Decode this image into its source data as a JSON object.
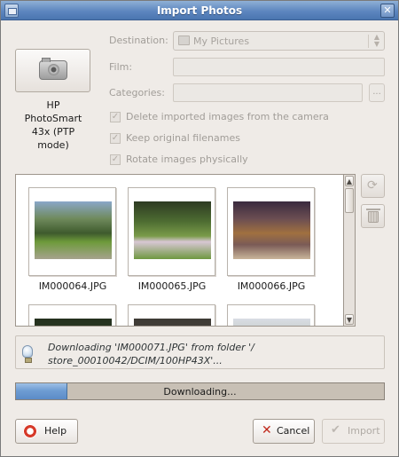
{
  "window": {
    "title": "Import Photos"
  },
  "device": {
    "name_lines": [
      "HP",
      "PhotoSmart",
      "43x (PTP",
      "mode)"
    ]
  },
  "form": {
    "destination_label": "Destination:",
    "destination_value": "My Pictures",
    "film_label": "Film:",
    "categories_label": "Categories:",
    "categories_button": "..."
  },
  "options": [
    {
      "label": "Delete imported images from the camera",
      "checked": true,
      "enabled": false
    },
    {
      "label": "Keep original filenames",
      "checked": true,
      "enabled": false
    },
    {
      "label": "Rotate images physically",
      "checked": true,
      "enabled": false
    }
  ],
  "thumbnails": [
    {
      "filename": "IM000064.JPG"
    },
    {
      "filename": "IM000065.JPG"
    },
    {
      "filename": "IM000066.JPG"
    },
    {
      "filename": ""
    },
    {
      "filename": ""
    },
    {
      "filename": ""
    }
  ],
  "status": {
    "message": "Downloading 'IM000071.JPG' from folder '/ store_00010042/DCIM/100HP43X'...",
    "progress_label": "Downloading...",
    "progress_fraction": 0.14
  },
  "buttons": {
    "help": "Help",
    "cancel": "Cancel",
    "import": "Import"
  },
  "colors": {
    "titlebar": "#5d86bf",
    "progress_fill": "#6f9dd3",
    "cancel_icon": "#c0281b"
  }
}
